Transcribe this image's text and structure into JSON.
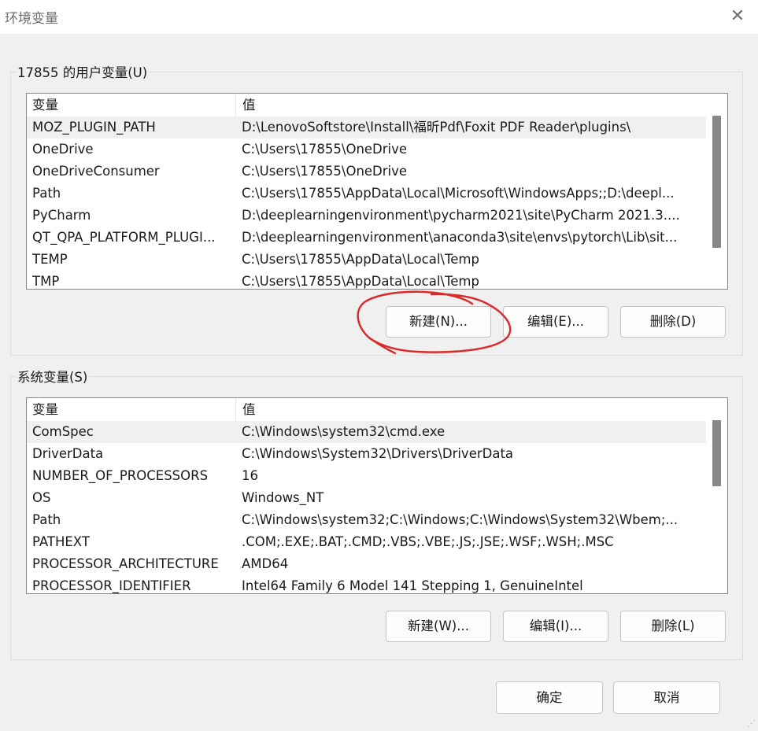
{
  "window": {
    "title": "环境变量",
    "close_icon": "close-icon"
  },
  "user_group": {
    "label": "17855 的用户变量(U)",
    "columns": {
      "name": "变量",
      "value": "值"
    },
    "rows": [
      {
        "name": "MOZ_PLUGIN_PATH",
        "value": "D:\\LenovoSoftstore\\Install\\福昕Pdf\\Foxit PDF Reader\\plugins\\"
      },
      {
        "name": "OneDrive",
        "value": "C:\\Users\\17855\\OneDrive"
      },
      {
        "name": "OneDriveConsumer",
        "value": "C:\\Users\\17855\\OneDrive"
      },
      {
        "name": "Path",
        "value": "C:\\Users\\17855\\AppData\\Local\\Microsoft\\WindowsApps;;D:\\deepl..."
      },
      {
        "name": "PyCharm",
        "value": "D:\\deeplearningenvironment\\pycharm2021\\site\\PyCharm 2021.3...."
      },
      {
        "name": "QT_QPA_PLATFORM_PLUGI...",
        "value": "D:\\deeplearningenvironment\\anaconda3\\site\\envs\\pytorch\\Lib\\sit..."
      },
      {
        "name": "TEMP",
        "value": "C:\\Users\\17855\\AppData\\Local\\Temp"
      },
      {
        "name": "TMP",
        "value": "C:\\Users\\17855\\AppData\\Local\\Temp"
      }
    ],
    "buttons": {
      "new": "新建(N)...",
      "edit": "编辑(E)...",
      "delete": "删除(D)"
    }
  },
  "system_group": {
    "label": "系统变量(S)",
    "columns": {
      "name": "变量",
      "value": "值"
    },
    "rows": [
      {
        "name": "ComSpec",
        "value": "C:\\Windows\\system32\\cmd.exe"
      },
      {
        "name": "DriverData",
        "value": "C:\\Windows\\System32\\Drivers\\DriverData"
      },
      {
        "name": "NUMBER_OF_PROCESSORS",
        "value": "16"
      },
      {
        "name": "OS",
        "value": "Windows_NT"
      },
      {
        "name": "Path",
        "value": "C:\\Windows\\system32;C:\\Windows;C:\\Windows\\System32\\Wbem;..."
      },
      {
        "name": "PATHEXT",
        "value": ".COM;.EXE;.BAT;.CMD;.VBS;.VBE;.JS;.JSE;.WSF;.WSH;.MSC"
      },
      {
        "name": "PROCESSOR_ARCHITECTURE",
        "value": "AMD64"
      },
      {
        "name": "PROCESSOR_IDENTIFIER",
        "value": "Intel64 Family 6 Model 141 Stepping 1, GenuineIntel"
      }
    ],
    "buttons": {
      "new": "新建(W)...",
      "edit": "编辑(I)...",
      "delete": "删除(L)"
    }
  },
  "footer": {
    "ok": "确定",
    "cancel": "取消"
  },
  "colors": {
    "annotation": "#d92b2b",
    "selected_row": "#f0f0f0",
    "scrollbar": "#888888"
  }
}
